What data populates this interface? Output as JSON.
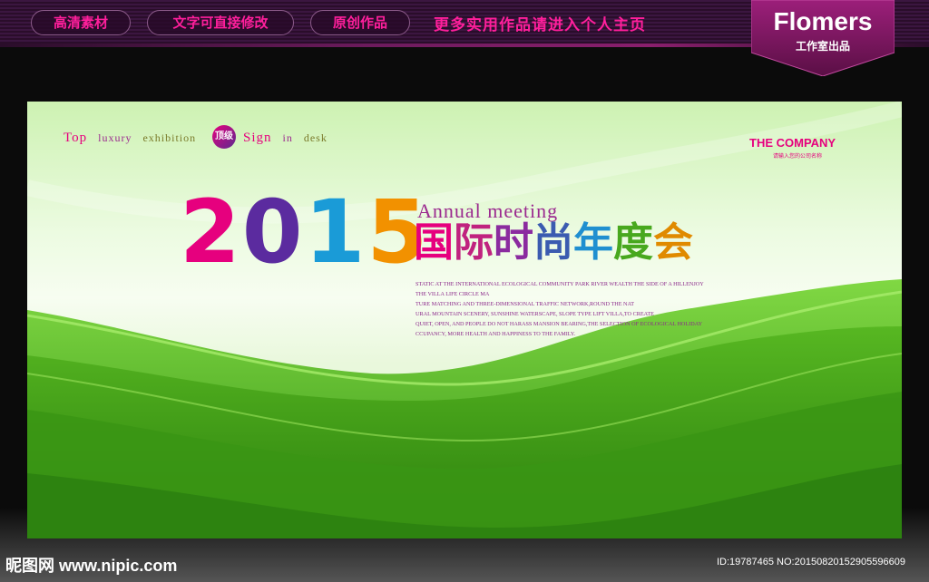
{
  "header": {
    "pills": [
      "高清素材",
      "文字可直接修改",
      "原创作品"
    ],
    "promo": "更多实用作品请进入个人主页",
    "logo_name": "Flomers",
    "logo_sub": "工作室出品"
  },
  "poster": {
    "tagline_words": [
      "Top",
      "luxury",
      "exhibition"
    ],
    "badge": "顶级",
    "tagline_words2": [
      "Sign",
      "in",
      "desk"
    ],
    "company": "THE COMPANY",
    "company_sub": "请输入您的公司名称",
    "year": "2015",
    "annual": "Annual meeting",
    "cn_title": "国际时尚年度会",
    "description": [
      "STATIC AT THE INTERNATIONAL ECOLOGICAL COMMUNITY PARK RIVER WEALTH THE SIDE OF A HILLENJOY",
      "THE VILLA LIFE CIRCLE MA",
      "TURE MATCHING AND THREE-DIMENSIONAL TRAFFIC NETWORK,ROUND THE NAT",
      "URAL MOUNTAIN SCENERY, SUNSHINE WATERSCAPE, SLOPE TYPE LIFT VILLA,TO CREATE",
      "QUIET, OPEN, AND PEOPLE DO NOT HARASS MANSION BEARING,THE SELECTION OF ECOLOGICAL HOLIDAY",
      "CCUPANCY, MORE HEALTH AND HAPPINESS TO THE FAMILY."
    ]
  },
  "footer": {
    "watermark": "昵图网 www.nipic.com",
    "id_text": "ID:19787465 NO:20150820152905596609"
  },
  "colors": {
    "pink": "#ff1f9c",
    "green_dark": "#3c9a12",
    "green_light": "#7fd33a",
    "background": "#0b0b0b"
  }
}
